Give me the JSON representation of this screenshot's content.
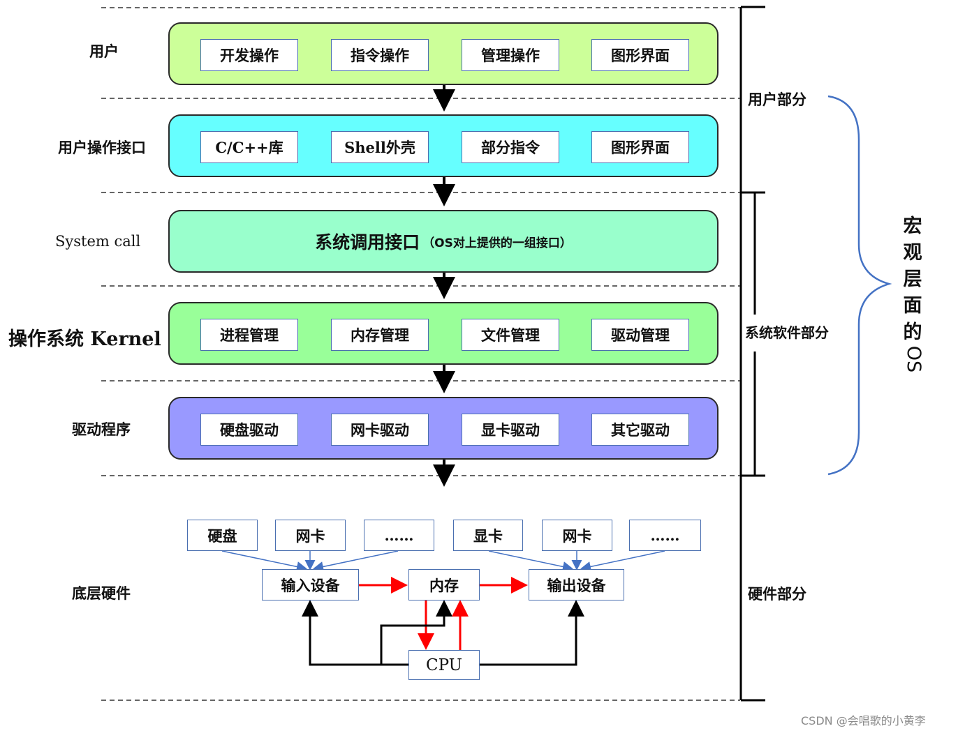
{
  "colors": {
    "user_layer": "#ccff99",
    "interface_layer": "#66ffff",
    "syscall_layer": "#99ffcc",
    "kernel_layer": "#99ff99",
    "driver_layer": "#9999ff",
    "hardware_layer": "#99ccff",
    "brace": "#4472c4",
    "data_flow_arrow": "#ff0000",
    "control_arrow": "#000000"
  },
  "layers": [
    {
      "label": "用户",
      "items": [
        "开发操作",
        "指令操作",
        "管理操作",
        "图形界面"
      ]
    },
    {
      "label": "用户操作接口",
      "items": [
        "C/C++库",
        "Shell外壳",
        "部分指令",
        "图形界面"
      ]
    },
    {
      "label": "System call",
      "title": "系统调用接口",
      "subtitle": "（OS对上提供的一组接口）"
    },
    {
      "label": "操作系统 Kernel",
      "items": [
        "进程管理",
        "内存管理",
        "文件管理",
        "驱动管理"
      ]
    },
    {
      "label": "驱动程序",
      "items": [
        "硬盘驱动",
        "网卡驱动",
        "显卡驱动",
        "其它驱动"
      ]
    },
    {
      "label": "底层硬件",
      "input_sources": [
        "硬盘",
        "网卡",
        "……"
      ],
      "output_sources": [
        "显卡",
        "网卡",
        "……"
      ],
      "input_device": "输入设备",
      "memory": "内存",
      "output_device": "输出设备",
      "cpu": "CPU"
    }
  ],
  "sections": {
    "user": "用户部分",
    "system_software": "系统软件部分",
    "hardware": "硬件部分"
  },
  "macro_os_label": [
    "宏",
    "观",
    "层",
    "面",
    "的",
    "OS"
  ],
  "watermark": "CSDN @会唱歌的小黄李"
}
